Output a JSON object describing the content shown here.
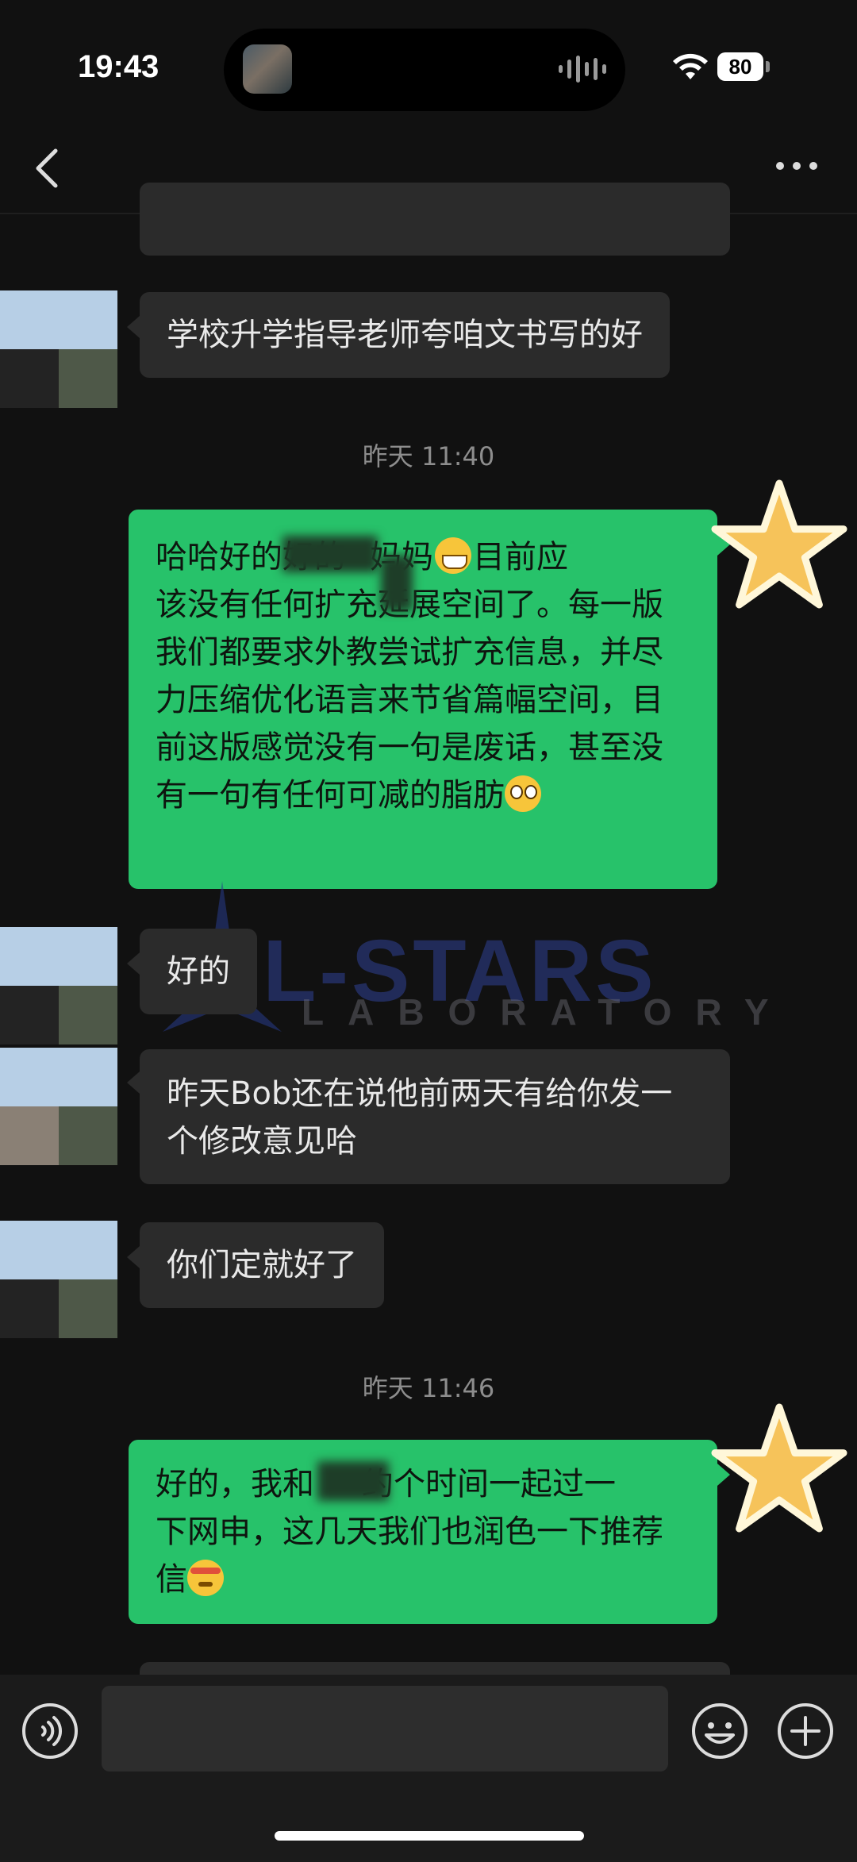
{
  "status_bar": {
    "time": "19:43",
    "battery": "80",
    "icons": [
      "wifi-icon",
      "battery-icon"
    ]
  },
  "nav": {
    "icons": [
      "back-icon",
      "more-icon"
    ]
  },
  "messages": [
    {
      "from": "contact",
      "text": "学校升学指导老师夸咱文书写的好"
    },
    {
      "type": "time",
      "text": "昨天 11:40"
    },
    {
      "from": "me",
      "line1_a": "哈哈好的好的",
      "line1_b": "妈妈",
      "line1_c": "目前应",
      "rest": "该没有任何扩充延展空间了。每一版我们都要求外教尝试扩充信息，并尽力压缩优化语言来节省篇幅空间，目前这版感觉没有一句是废话，甚至没有一句有任何可减的脂肪",
      "emojis": [
        "grin-emoji",
        "pleading-emoji"
      ]
    },
    {
      "from": "contact",
      "text": "好的"
    },
    {
      "from": "contact",
      "text": "昨天Bob还在说他前两天有给你发一个修改意见哈"
    },
    {
      "from": "contact",
      "text": "你们定就好了"
    },
    {
      "type": "time",
      "text": "昨天 11:46"
    },
    {
      "from": "me",
      "line1_a": "好的，我和",
      "line1_b": "约个时间一起过一",
      "rest": "下网申，这几天我们也润色一下推荐信",
      "emojis": [
        "saluting-face-emoji"
      ]
    }
  ],
  "watermark": {
    "top": "LL-STARS",
    "bottom": "LABORATORY"
  },
  "input_bar": {
    "icons": [
      "voice-icon",
      "emoji-icon",
      "plus-icon"
    ]
  },
  "colors": {
    "background": "#111111",
    "incoming_bubble": "#2b2b2b",
    "outgoing_bubble": "#27c26a"
  }
}
